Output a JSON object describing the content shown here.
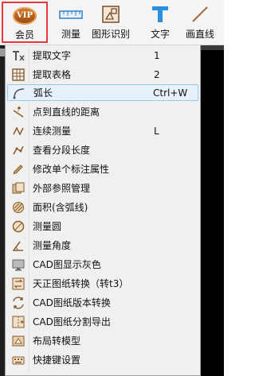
{
  "toolbar": {
    "items": [
      {
        "label": "会员",
        "badge": "VIP"
      },
      {
        "label": "测量"
      },
      {
        "label": "图形识别"
      },
      {
        "label": "文字"
      },
      {
        "label": "画直线"
      }
    ],
    "active_index": 0
  },
  "menu": {
    "items": [
      {
        "label": "提取文字",
        "shortcut": "1",
        "icon": "extract-text-icon"
      },
      {
        "label": "提取表格",
        "shortcut": "2",
        "icon": "extract-table-icon"
      },
      {
        "label": "弧长",
        "shortcut": "Ctrl+W",
        "icon": "arc-length-icon"
      },
      {
        "label": "点到直线的距离",
        "shortcut": "",
        "icon": "point-to-line-icon"
      },
      {
        "label": "连续测量",
        "shortcut": "L",
        "icon": "continuous-measure-icon"
      },
      {
        "label": "查看分段长度",
        "shortcut": "",
        "icon": "segment-length-icon"
      },
      {
        "label": "修改单个标注属性",
        "shortcut": "",
        "icon": "edit-annotation-icon"
      },
      {
        "label": "外部参照管理",
        "shortcut": "",
        "icon": "xref-icon"
      },
      {
        "label": "面积(含弧线)",
        "shortcut": "",
        "icon": "area-arc-icon"
      },
      {
        "label": "测量圆",
        "shortcut": "",
        "icon": "measure-circle-icon"
      },
      {
        "label": "测量角度",
        "shortcut": "",
        "icon": "measure-angle-icon"
      },
      {
        "label": "CAD图显示灰色",
        "shortcut": "",
        "icon": "gray-display-icon"
      },
      {
        "label": "天正图纸转换（转t3）",
        "shortcut": "",
        "icon": "tangent-convert-icon"
      },
      {
        "label": "CAD图纸版本转换",
        "shortcut": "",
        "icon": "version-convert-icon"
      },
      {
        "label": "CAD图纸分割导出",
        "shortcut": "",
        "icon": "split-export-icon"
      },
      {
        "label": "布局转模型",
        "shortcut": "",
        "icon": "layout-to-model-icon"
      },
      {
        "label": "快捷键设置",
        "shortcut": "",
        "icon": "shortcut-settings-icon"
      }
    ],
    "hover_index": 2
  }
}
